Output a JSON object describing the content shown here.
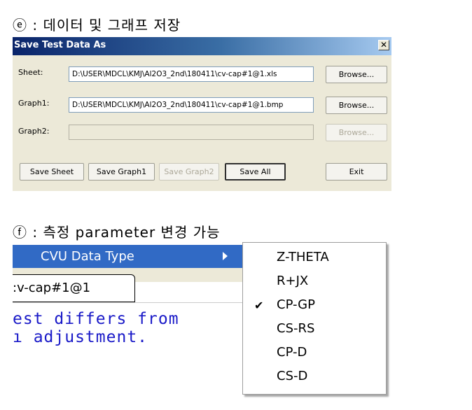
{
  "captions": {
    "e": "ⓔ : 데이터 및 그래프 저장",
    "f": "ⓕ : 측정 parameter 변경 가능"
  },
  "dialog": {
    "title": "Save Test Data As",
    "close_symbol": "✕",
    "rows": [
      {
        "label": "Sheet:",
        "value": "D:\\USER\\MDCL\\KMJ\\Al2O3_2nd\\180411\\cv-cap#1@1.xls",
        "browse": "Browse...",
        "enabled": true
      },
      {
        "label": "Graph1:",
        "value": "D:\\USER\\MDCL\\KMJ\\Al2O3_2nd\\180411\\cv-cap#1@1.bmp",
        "browse": "Browse...",
        "enabled": true
      },
      {
        "label": "Graph2:",
        "value": "",
        "browse": "Browse...",
        "enabled": false
      }
    ],
    "buttons": {
      "save_sheet": "Save Sheet",
      "save_graph1": "Save Graph1",
      "save_graph2": "Save Graph2",
      "save_all": "Save All",
      "exit": "Exit"
    }
  },
  "cvu": {
    "menu_item": "CVU Data Type",
    "tab_label": ":v-cap#1@1",
    "text_line_1": "est differs from",
    "text_line_2": "ı adjustment.",
    "submenu_items": [
      {
        "label": "Z-THETA",
        "checked": false
      },
      {
        "label": "R+JX",
        "checked": false
      },
      {
        "label": "CP-GP",
        "checked": true
      },
      {
        "label": "CS-RS",
        "checked": false
      },
      {
        "label": "CP-D",
        "checked": false
      },
      {
        "label": "CS-D",
        "checked": false
      }
    ],
    "check_symbol": "✔"
  },
  "colors": {
    "titlebar": "#0a246a",
    "menu_highlight": "#316ac5",
    "dialog_bg": "#ece9d8",
    "code_text": "#1a1ac8"
  }
}
